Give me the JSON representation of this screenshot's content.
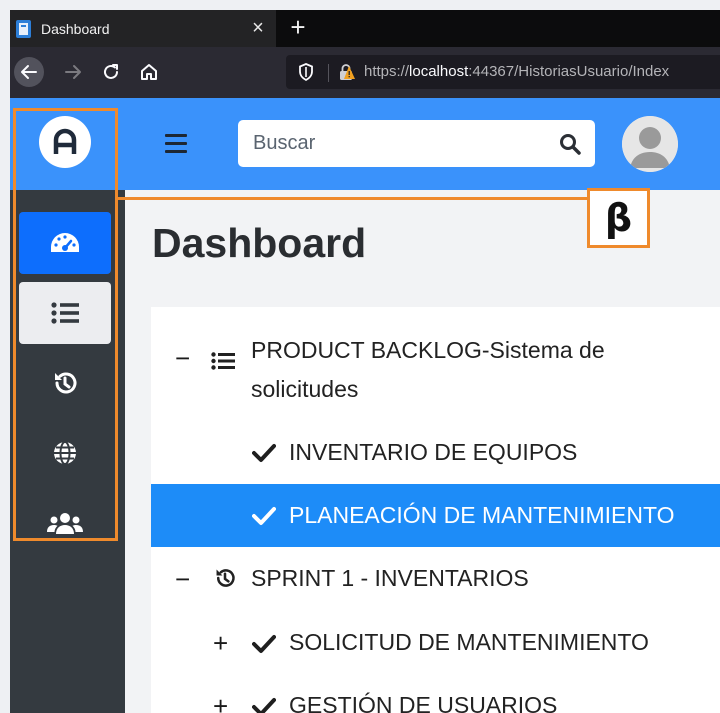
{
  "browser": {
    "tab_title": "Dashboard",
    "tab_close": "×",
    "new_tab": "+",
    "url_host": "localhost",
    "url_prefix": "https://",
    "url_path": ":44367/HistoriasUsuario/Index"
  },
  "sidebar": {
    "brand_letter": "A",
    "items": [
      {
        "icon": "dashboard-gauge-icon",
        "state": "active"
      },
      {
        "icon": "list-icon",
        "state": "selected"
      },
      {
        "icon": "history-icon",
        "state": "normal"
      },
      {
        "icon": "globe-icon",
        "state": "normal"
      },
      {
        "icon": "users-icon",
        "state": "normal"
      }
    ]
  },
  "header": {
    "search_placeholder": "Buscar"
  },
  "page": {
    "title": "Dashboard"
  },
  "tree": {
    "backlog_line1": "PRODUCT BACKLOG-Sistema de",
    "backlog_line2": "solicitudes",
    "item1": "INVENTARIO DE EQUIPOS",
    "item2": "PLANEACIÓN DE MANTENIMIENTO",
    "sprint": "SPRINT 1 - INVENTARIOS",
    "item3": "SOLICITUD DE MANTENIMIENTO",
    "item4": "GESTIÓN DE USUARIOS",
    "collapse_symbol": "−",
    "expand_symbol": "+"
  },
  "annotation": {
    "label": "β",
    "color": "#ef8a2c"
  },
  "colors": {
    "accent": "#3a92fb",
    "active_nav": "#0d6efd",
    "selected_row": "#1d8cf8",
    "sidebar_bg": "#343a40"
  }
}
